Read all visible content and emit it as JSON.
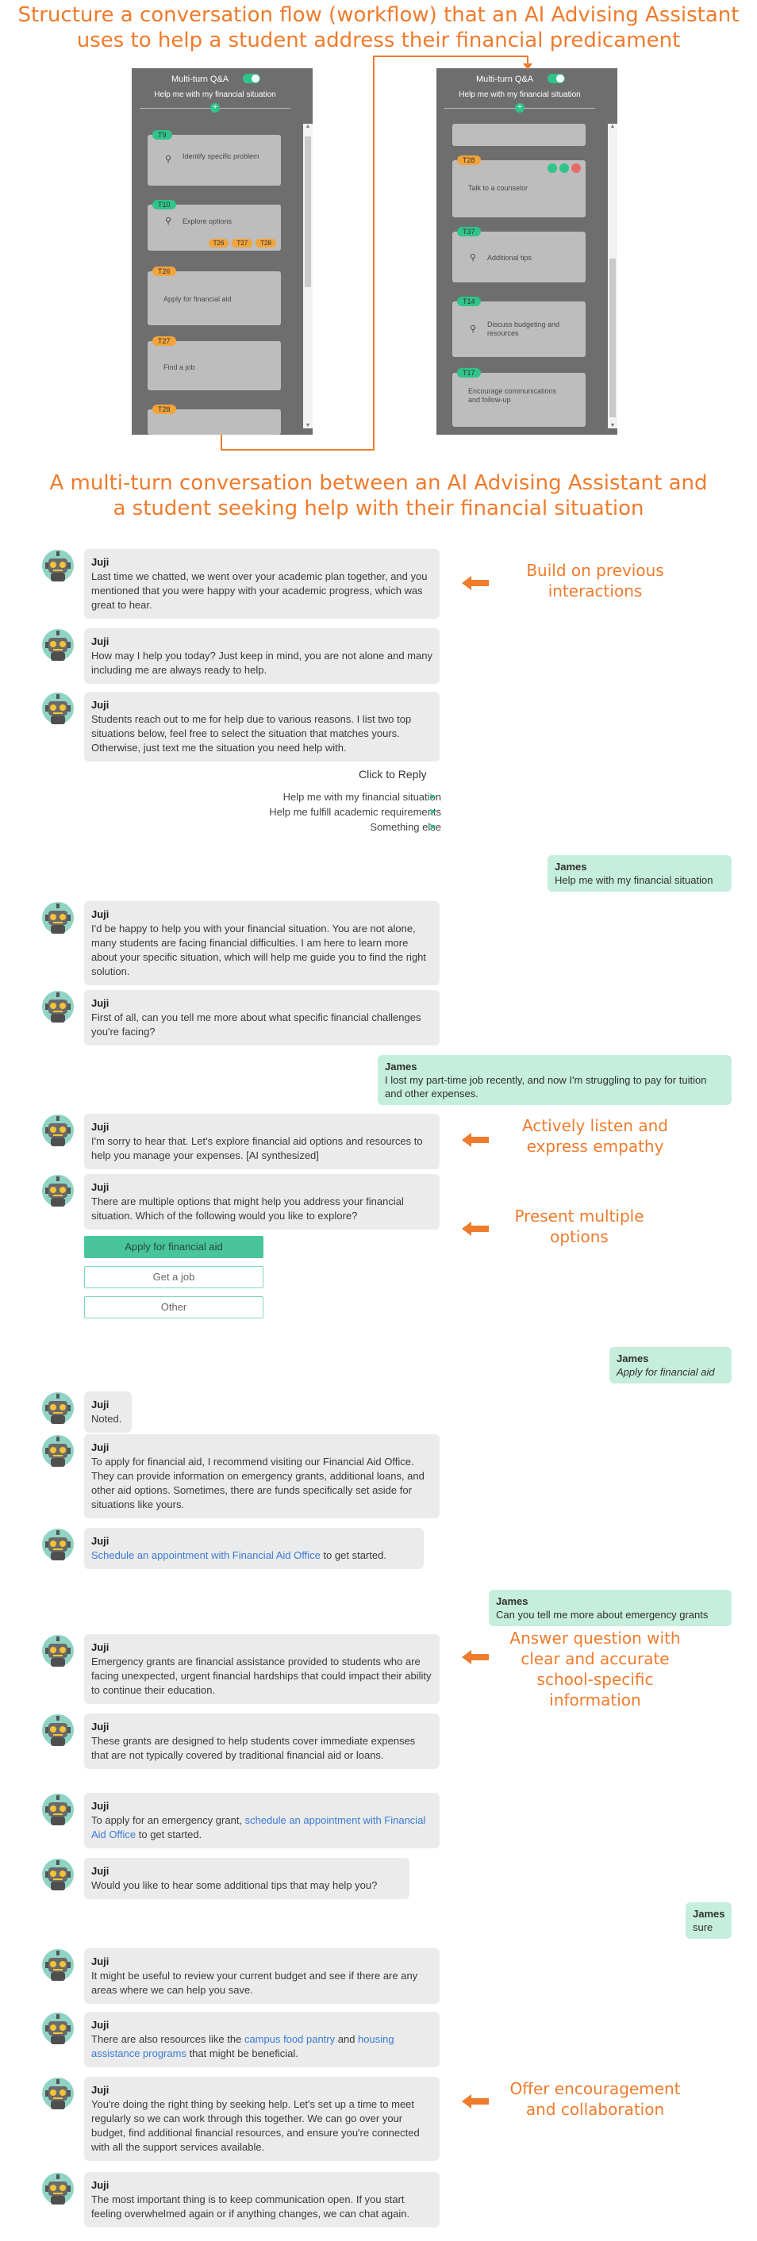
{
  "headline_top": "Structure a conversation flow (workflow) that an AI Advising Assistant\nuses to help a student address their financial predicament",
  "headline_mid": "A multi-turn conversation between an AI Advising Assistant and\na student seeking help with their financial situation",
  "colors": {
    "accent": "#ef7b2c",
    "green": "#2fc48a",
    "user_bubble": "#c6eedd",
    "bot_bubble": "#ebebeb",
    "link": "#3b7bd5"
  },
  "panels": {
    "title": "Multi-turn Q&A",
    "subtitle": "Help me with my financial situation",
    "left_cards": [
      {
        "tag": "T9",
        "tag_color": "green",
        "text": "Identify specific problem",
        "icon": "chat-icon"
      },
      {
        "tag": "T10",
        "tag_color": "green",
        "text": "Explore options",
        "icon": "chat-icon",
        "mini_tags": [
          "T26",
          "T27",
          "T28"
        ]
      },
      {
        "tag": "T26",
        "tag_color": "orange",
        "text": "Apply for financial aid"
      },
      {
        "tag": "T27",
        "tag_color": "orange",
        "text": "Find a job"
      },
      {
        "tag": "T28",
        "tag_color": "orange",
        "text": ""
      }
    ],
    "right_cards": [
      {
        "tag": "",
        "text": ""
      },
      {
        "tag": "T28",
        "tag_color": "orange",
        "text": "Talk to a counselor"
      },
      {
        "tag": "T37",
        "tag_color": "green",
        "text": "Additional tips",
        "icon": "chat-icon"
      },
      {
        "tag": "T14",
        "tag_color": "green",
        "text": "Discuss budgeting and resources",
        "icon": "chat-icon"
      },
      {
        "tag": "T17",
        "tag_color": "green",
        "text": "Encourage communications and follow-up"
      }
    ]
  },
  "bot_name": "Juji",
  "user_name": "James",
  "messages": {
    "m1": "Last time we chatted, we went over your academic plan together, and you mentioned that you were happy with your academic progress, which was great to hear.",
    "m2": "How may I help you today? Just keep in mind, you are not alone and many including me are always ready to help.",
    "m3": "Students reach out to me for help due to various reasons. I list two top situations below, feel free to select the situation that matches yours. Otherwise, just text me the situation you need help with.",
    "click_to_reply": "Click to Reply",
    "reply_options": [
      "Help me with my financial situation",
      "Help me fulfill academic requirements",
      "Something else"
    ],
    "u1": "Help me with my financial situation",
    "m4": "I'd be happy to help you with your financial situation. You are not alone, many students are facing financial difficulties. I am here to learn more about your specific situation, which will help me guide you to find the right solution.",
    "m5": "First of all, can you tell me more about what specific financial challenges you're facing?",
    "u2": "I lost my part-time job recently, and now I'm struggling to pay for tuition and other expenses.",
    "m6": "I'm sorry to hear that. Let's explore financial aid options and resources to help you manage your expenses. [AI synthesized]",
    "m7": "There are multiple options that might help you address your financial situation. Which of the following would you like to explore?",
    "option_buttons": [
      "Apply for financial aid",
      "Get a job",
      "Other"
    ],
    "u3": "Apply for financial aid",
    "m8": "Noted.",
    "m9": "To apply for financial aid, I recommend visiting our Financial Aid Office. They can provide information on emergency grants, additional loans, and other aid options. Sometimes, there are funds specifically set aside for situations like yours.",
    "m10_link": "Schedule an appointment with Financial Aid Office",
    "m10_rest": " to get started.",
    "u4": "Can you tell me more about emergency grants",
    "m11": "Emergency grants are financial assistance provided to students who are facing unexpected, urgent financial hardships that could impact their ability to continue their education.",
    "m12": "These grants are designed to help students cover immediate expenses that are not typically covered by traditional financial aid or loans.",
    "m13_pre": "To apply for an emergency grant, ",
    "m13_link": "schedule an appointment with Financial Aid Office",
    "m13_post": " to get started.",
    "m14": "Would you like to hear some additional tips that may help you?",
    "u5": "sure",
    "m15": "It might be useful to review your current budget and see if there are any areas where we can help you save.",
    "m16_pre": "There are also resources like the ",
    "m16_link1": "campus food pantry",
    "m16_mid": " and ",
    "m16_link2": "housing assistance programs",
    "m16_post": " that might be beneficial.",
    "m17": "You're doing the right thing by seeking help. Let's set up a time to meet regularly so we can work through this together. We can go over your budget, find additional financial resources, and ensure you're connected with all the support services available.",
    "m18": "The most important thing is to keep communication open. If you start feeling overwhelmed again or if anything changes, we can chat again."
  },
  "annotations": {
    "a1": "Build on previous\ninteractions",
    "a2": "Actively listen and\nexpress empathy",
    "a3": "Present multiple\noptions",
    "a4": "Answer question with\nclear and accurate\nschool-specific\ninformation",
    "a5": "Offer encouragement\nand collaboration"
  }
}
